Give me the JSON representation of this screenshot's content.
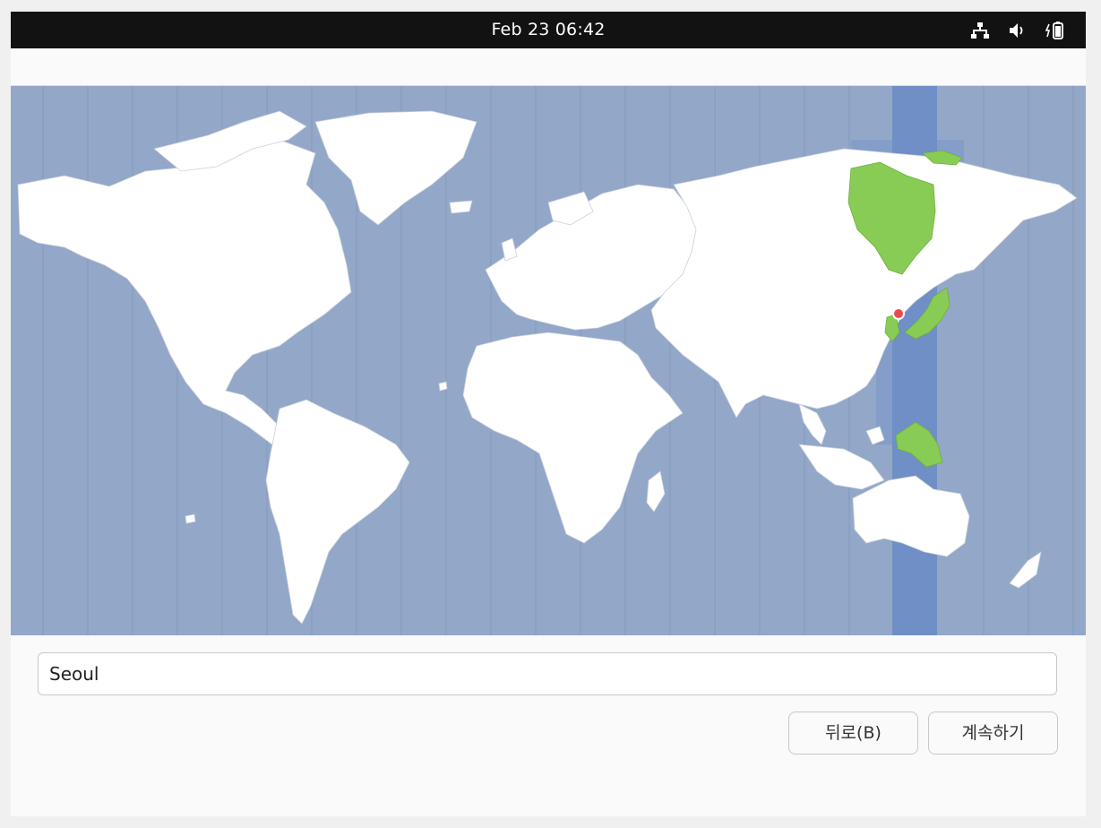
{
  "topbar": {
    "datetime": "Feb 23  06:42",
    "icons": [
      "network-icon",
      "volume-icon",
      "battery-icon"
    ]
  },
  "header": {
    "title": ""
  },
  "map": {
    "selected_city": "Seoul",
    "colors": {
      "ocean": "#93a7c8",
      "land": "#ffffff",
      "selected_zone_band": "#6f8fc6",
      "selected_zone_land": "#88cc55",
      "marker": "#e84d4d"
    }
  },
  "timezone_field": {
    "value": "Seoul"
  },
  "buttons": {
    "back": "뒤로(B)",
    "continue": "계속하기"
  }
}
